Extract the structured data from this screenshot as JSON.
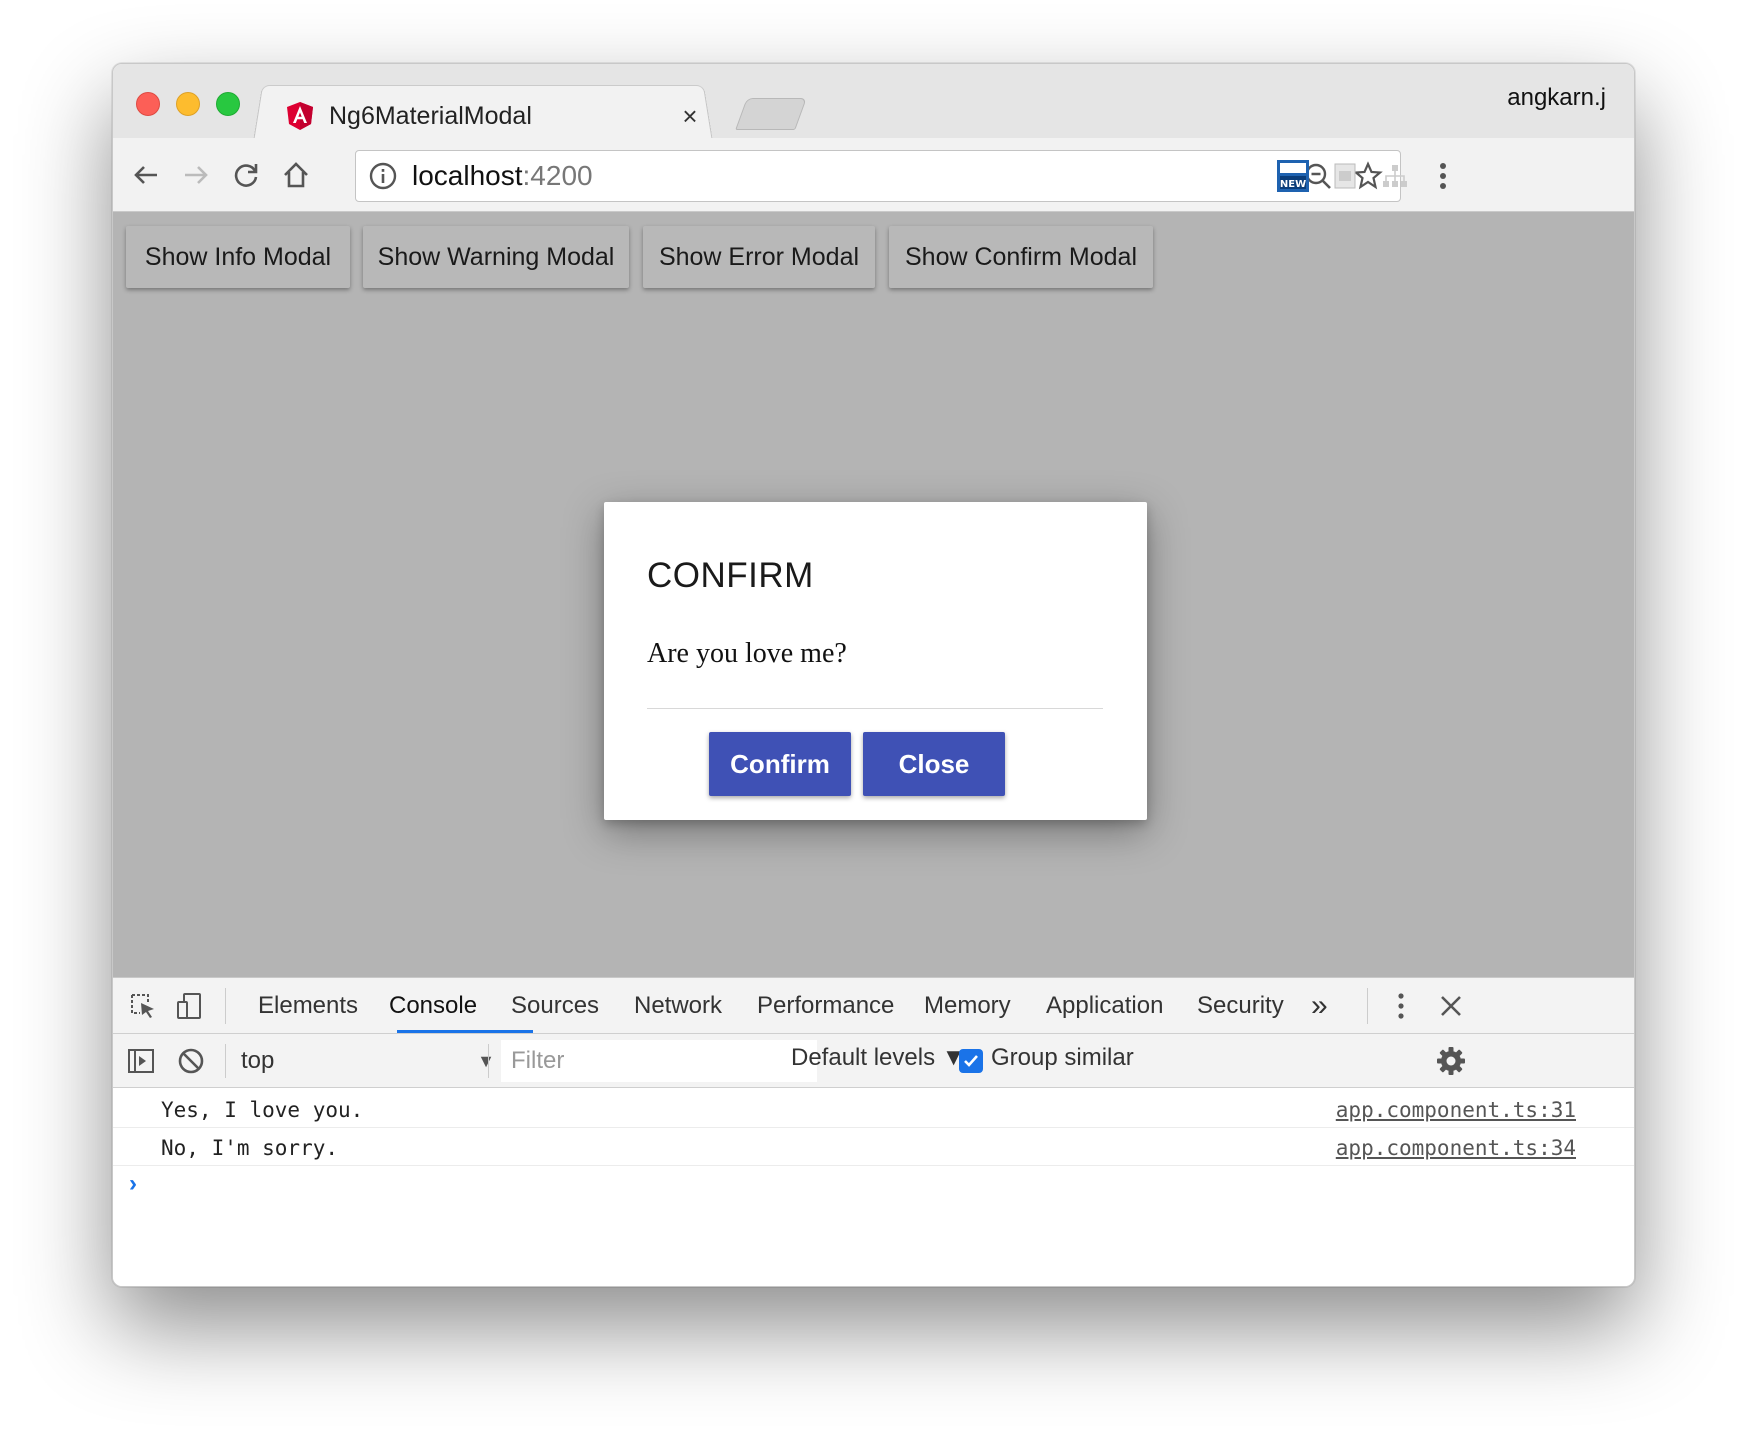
{
  "browser": {
    "tab_title": "Ng6MaterialModal",
    "tab_close": "×",
    "profile_name": "angkarn.j",
    "url_host": "localhost",
    "url_port": ":4200"
  },
  "page": {
    "buttons": [
      {
        "label": "Show Info Modal"
      },
      {
        "label": "Show Warning Modal"
      },
      {
        "label": "Show Error Modal"
      },
      {
        "label": "Show Confirm Modal"
      }
    ]
  },
  "modal": {
    "title": "CONFIRM",
    "message": "Are you love me?",
    "confirm_label": "Confirm",
    "close_label": "Close",
    "accent_color": "#3f51b5"
  },
  "devtools": {
    "tabs": [
      {
        "label": "Elements"
      },
      {
        "label": "Console"
      },
      {
        "label": "Sources"
      },
      {
        "label": "Network"
      },
      {
        "label": "Performance"
      },
      {
        "label": "Memory"
      },
      {
        "label": "Application"
      },
      {
        "label": "Security"
      }
    ],
    "active_tab": "Console",
    "more_tabs": "»",
    "context": "top",
    "filter_placeholder": "Filter",
    "levels": "Default levels ▼",
    "group_similar": "Group similar",
    "group_similar_checked": true,
    "console_rows": [
      {
        "message": "Yes, I love you.",
        "source": "app.component.ts:31"
      },
      {
        "message": "No, I'm sorry.",
        "source": "app.component.ts:34"
      }
    ],
    "prompt": "›"
  },
  "icons": {
    "favicon": "angular-icon",
    "back": "arrow-left-icon",
    "forward": "arrow-right-icon",
    "reload": "reload-icon",
    "home": "home-icon",
    "site_info": "info-icon",
    "zoom": "zoom-out-icon",
    "bookmark": "star-icon",
    "menu": "kebab-menu-icon"
  }
}
